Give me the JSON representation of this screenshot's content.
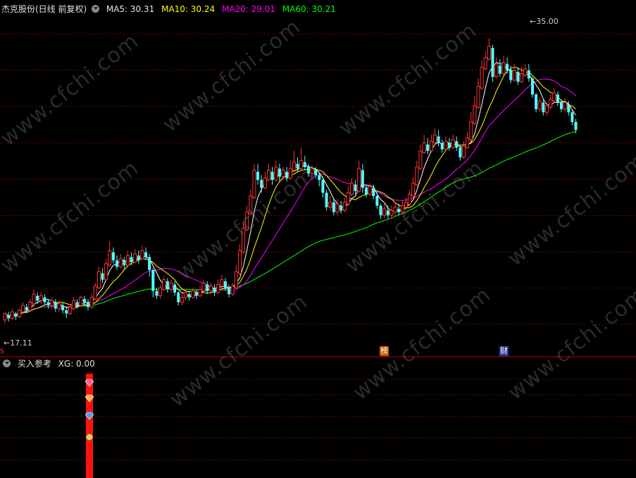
{
  "main_header": {
    "title": "杰克股份(日线 前复权)",
    "ma5": "MA5: 30.31",
    "ma10": "MA10: 30.24",
    "ma20": "MA20: 29.01",
    "ma60": "MA60: 30.21"
  },
  "sub_header": {
    "title": "买入参考",
    "xg": "XG: 0.00"
  },
  "watermark": "www.cfchi.com",
  "markers": {
    "bang": "榜",
    "cai": "财",
    "high_label": "35.00",
    "low_label": "17.11",
    "axis_label": "S"
  },
  "colors": {
    "background": "#000000",
    "grid": "#7a0000",
    "divider": "#c00000",
    "up_candle": "#ff3232",
    "down_candle": "#54ffff",
    "ma5": "#ffffff",
    "ma10": "#ffff00",
    "ma20": "#ff00ff",
    "ma60": "#00ff00",
    "signal_bar": "#ff1010"
  },
  "chart_data": {
    "type": "candlestick",
    "price_range": [
      16.0,
      36.5
    ],
    "high_marker": 35.0,
    "low_marker": 17.11,
    "grid": true,
    "signal_indicator": {
      "name": "XG",
      "value": 0.0,
      "icons": [
        "gem-icon",
        "gem-icon",
        "diamond-icon",
        "money-bag-icon"
      ]
    },
    "candles": [
      [
        17.5,
        17.9,
        17.3,
        18.0
      ],
      [
        17.8,
        17.6,
        17.4,
        18.0
      ],
      [
        17.6,
        18.0,
        17.5,
        18.2
      ],
      [
        17.9,
        17.7,
        17.5,
        18.0
      ],
      [
        17.7,
        18.1,
        17.6,
        18.2
      ],
      [
        18.0,
        18.4,
        17.9,
        18.6
      ],
      [
        18.3,
        18.1,
        17.9,
        18.5
      ],
      [
        18.1,
        18.6,
        18.0,
        18.8
      ],
      [
        18.5,
        19.1,
        18.3,
        19.4
      ],
      [
        19.0,
        18.7,
        18.5,
        19.2
      ],
      [
        18.7,
        19.0,
        18.5,
        19.2
      ],
      [
        18.9,
        18.6,
        18.4,
        19.1
      ],
      [
        18.6,
        18.4,
        18.2,
        18.8
      ],
      [
        18.4,
        18.7,
        18.2,
        18.9
      ],
      [
        18.6,
        18.2,
        18.0,
        18.8
      ],
      [
        18.2,
        18.5,
        18.0,
        18.7
      ],
      [
        18.4,
        18.1,
        17.9,
        18.6
      ],
      [
        18.1,
        17.9,
        17.6,
        18.3
      ],
      [
        17.9,
        18.3,
        17.8,
        18.5
      ],
      [
        18.2,
        18.7,
        18.1,
        18.9
      ],
      [
        18.6,
        18.4,
        18.2,
        18.8
      ],
      [
        18.4,
        18.9,
        18.3,
        19.0
      ],
      [
        18.8,
        18.6,
        18.4,
        19.0
      ],
      [
        18.6,
        18.3,
        18.1,
        18.8
      ],
      [
        18.3,
        18.9,
        18.2,
        19.1
      ],
      [
        18.8,
        19.6,
        18.7,
        19.8
      ],
      [
        19.5,
        20.5,
        19.4,
        20.8
      ],
      [
        20.4,
        20.0,
        19.8,
        20.7
      ],
      [
        20.0,
        21.0,
        19.9,
        21.3
      ],
      [
        20.9,
        21.8,
        20.8,
        22.4
      ],
      [
        21.7,
        21.2,
        21.0,
        22.0
      ],
      [
        21.2,
        20.8,
        20.6,
        21.5
      ],
      [
        20.8,
        21.3,
        20.7,
        21.6
      ],
      [
        21.2,
        20.9,
        20.6,
        21.4
      ],
      [
        20.9,
        21.5,
        20.8,
        21.8
      ],
      [
        21.4,
        21.1,
        20.9,
        21.7
      ],
      [
        21.1,
        21.6,
        21.0,
        21.9
      ],
      [
        21.5,
        21.2,
        21.0,
        21.8
      ],
      [
        21.3,
        21.8,
        21.2,
        22.1
      ],
      [
        21.7,
        21.4,
        21.2,
        22.0
      ],
      [
        21.4,
        20.6,
        20.2,
        21.6
      ],
      [
        20.6,
        19.3,
        18.9,
        20.7
      ],
      [
        19.3,
        19.0,
        18.8,
        19.5
      ],
      [
        19.0,
        19.5,
        18.8,
        19.7
      ],
      [
        19.4,
        20.0,
        19.3,
        20.2
      ],
      [
        19.9,
        19.4,
        19.2,
        20.1
      ],
      [
        19.4,
        19.8,
        19.2,
        20.0
      ],
      [
        19.7,
        19.2,
        19.0,
        19.9
      ],
      [
        19.2,
        18.6,
        18.4,
        19.3
      ],
      [
        18.6,
        18.9,
        18.4,
        19.1
      ],
      [
        18.9,
        19.2,
        18.7,
        19.4
      ],
      [
        19.1,
        18.9,
        18.7,
        19.3
      ],
      [
        18.9,
        19.3,
        18.8,
        19.5
      ],
      [
        19.2,
        19.0,
        18.8,
        19.4
      ],
      [
        19.0,
        19.4,
        18.9,
        19.6
      ],
      [
        19.3,
        19.8,
        19.2,
        20.0
      ],
      [
        19.7,
        19.3,
        19.1,
        19.9
      ],
      [
        19.3,
        19.6,
        19.1,
        19.8
      ],
      [
        19.5,
        19.2,
        19.0,
        19.7
      ],
      [
        19.2,
        19.7,
        19.1,
        20.0
      ],
      [
        19.6,
        20.0,
        19.5,
        20.3
      ],
      [
        19.9,
        19.5,
        19.3,
        20.1
      ],
      [
        19.5,
        19.1,
        18.9,
        19.7
      ],
      [
        19.1,
        19.6,
        19.0,
        19.8
      ],
      [
        19.5,
        20.5,
        19.4,
        20.9
      ],
      [
        20.4,
        21.8,
        20.3,
        22.2
      ],
      [
        21.7,
        23.2,
        21.6,
        23.6
      ],
      [
        23.1,
        24.2,
        23.0,
        24.6
      ],
      [
        24.1,
        25.2,
        24.0,
        25.6
      ],
      [
        25.1,
        26.8,
        25.0,
        27.2
      ],
      [
        26.7,
        26.2,
        25.9,
        27.2
      ],
      [
        26.2,
        25.7,
        25.4,
        26.5
      ],
      [
        25.7,
        26.3,
        25.6,
        26.7
      ],
      [
        26.2,
        26.8,
        26.1,
        27.2
      ],
      [
        26.7,
        26.2,
        25.9,
        27.0
      ],
      [
        26.2,
        27.0,
        26.1,
        27.4
      ],
      [
        26.9,
        26.4,
        26.1,
        27.2
      ],
      [
        26.4,
        26.8,
        26.2,
        27.0
      ],
      [
        26.7,
        26.3,
        26.1,
        27.0
      ],
      [
        26.3,
        26.9,
        26.2,
        27.4
      ],
      [
        26.8,
        27.3,
        26.7,
        28.0
      ],
      [
        27.2,
        26.9,
        26.7,
        27.6
      ],
      [
        26.9,
        27.4,
        26.8,
        28.2
      ],
      [
        27.3,
        27.0,
        26.8,
        27.7
      ],
      [
        27.0,
        26.6,
        26.4,
        27.2
      ],
      [
        26.6,
        26.9,
        26.4,
        27.1
      ],
      [
        26.8,
        26.5,
        26.3,
        27.0
      ],
      [
        26.5,
        26.2,
        25.8,
        26.7
      ],
      [
        26.2,
        25.4,
        25.1,
        26.4
      ],
      [
        25.4,
        24.5,
        24.3,
        25.6
      ],
      [
        24.5,
        24.8,
        24.3,
        25.2
      ],
      [
        24.8,
        24.2,
        24.0,
        25.0
      ],
      [
        24.2,
        24.7,
        24.0,
        25.0
      ],
      [
        24.6,
        24.3,
        24.1,
        24.9
      ],
      [
        24.3,
        24.8,
        24.2,
        25.1
      ],
      [
        24.7,
        25.4,
        24.6,
        25.8
      ],
      [
        25.3,
        26.0,
        25.2,
        26.3
      ],
      [
        25.9,
        25.5,
        25.3,
        26.2
      ],
      [
        25.5,
        26.9,
        25.4,
        27.4
      ],
      [
        26.8,
        25.7,
        25.4,
        27.2
      ],
      [
        25.7,
        25.3,
        25.1,
        25.9
      ],
      [
        25.3,
        25.8,
        25.2,
        26.0
      ],
      [
        25.7,
        25.2,
        25.0,
        25.9
      ],
      [
        25.2,
        24.6,
        24.4,
        25.4
      ],
      [
        24.6,
        24.0,
        23.8,
        24.7
      ],
      [
        24.0,
        24.4,
        23.8,
        24.8
      ],
      [
        24.3,
        24.0,
        23.8,
        24.6
      ],
      [
        24.0,
        24.3,
        23.8,
        24.6
      ],
      [
        24.2,
        24.5,
        24.0,
        24.8
      ],
      [
        24.4,
        24.2,
        24.0,
        24.7
      ],
      [
        24.2,
        24.6,
        24.1,
        24.9
      ],
      [
        24.5,
        24.8,
        24.3,
        25.1
      ],
      [
        24.7,
        25.3,
        24.6,
        25.6
      ],
      [
        25.2,
        26.0,
        25.1,
        26.4
      ],
      [
        25.9,
        27.0,
        25.8,
        27.4
      ],
      [
        26.9,
        28.0,
        26.8,
        28.4
      ],
      [
        27.9,
        28.5,
        27.8,
        29.0
      ],
      [
        28.4,
        28.0,
        27.8,
        28.8
      ],
      [
        28.0,
        28.6,
        27.9,
        29.0
      ],
      [
        28.5,
        29.0,
        28.4,
        29.4
      ],
      [
        28.9,
        28.5,
        28.3,
        29.3
      ],
      [
        28.5,
        28.1,
        27.9,
        28.7
      ],
      [
        28.1,
        28.6,
        28.0,
        28.9
      ],
      [
        28.5,
        28.2,
        28.0,
        28.8
      ],
      [
        28.2,
        28.7,
        28.1,
        29.0
      ],
      [
        28.6,
        28.2,
        28.0,
        28.9
      ],
      [
        28.2,
        27.6,
        27.4,
        28.4
      ],
      [
        27.6,
        28.3,
        27.5,
        28.6
      ],
      [
        28.2,
        28.8,
        28.1,
        29.2
      ],
      [
        28.7,
        29.8,
        28.6,
        30.4
      ],
      [
        29.7,
        30.8,
        29.6,
        31.4
      ],
      [
        30.7,
        32.0,
        30.6,
        32.5
      ],
      [
        31.9,
        33.2,
        31.8,
        33.6
      ],
      [
        33.1,
        33.8,
        33.0,
        34.2
      ],
      [
        33.7,
        34.5,
        33.6,
        35.0
      ],
      [
        34.4,
        32.6,
        32.3,
        34.6
      ],
      [
        32.6,
        33.4,
        32.5,
        33.8
      ],
      [
        33.3,
        32.8,
        32.6,
        33.7
      ],
      [
        32.8,
        33.5,
        32.7,
        33.9
      ],
      [
        33.4,
        33.0,
        32.8,
        33.8
      ],
      [
        33.0,
        32.4,
        32.2,
        33.3
      ],
      [
        32.4,
        33.0,
        32.3,
        33.4
      ],
      [
        32.9,
        32.3,
        32.1,
        33.2
      ],
      [
        32.3,
        32.8,
        32.2,
        33.2
      ],
      [
        32.7,
        33.1,
        32.6,
        33.4
      ],
      [
        33.0,
        32.5,
        32.3,
        33.4
      ],
      [
        32.5,
        31.5,
        31.3,
        32.6
      ],
      [
        31.5,
        30.6,
        30.4,
        31.6
      ],
      [
        30.6,
        31.1,
        30.4,
        31.3
      ],
      [
        31.0,
        30.4,
        30.2,
        31.2
      ],
      [
        30.4,
        30.8,
        30.2,
        31.0
      ],
      [
        30.7,
        31.2,
        30.6,
        31.5
      ],
      [
        31.1,
        31.6,
        31.0,
        31.9
      ],
      [
        31.5,
        31.0,
        30.8,
        31.7
      ],
      [
        31.0,
        30.6,
        30.4,
        31.2
      ],
      [
        30.6,
        31.0,
        30.4,
        31.3
      ],
      [
        30.9,
        30.4,
        30.2,
        31.1
      ],
      [
        30.4,
        29.8,
        29.6,
        30.5
      ],
      [
        29.8,
        29.3,
        29.1,
        30.0
      ]
    ]
  }
}
